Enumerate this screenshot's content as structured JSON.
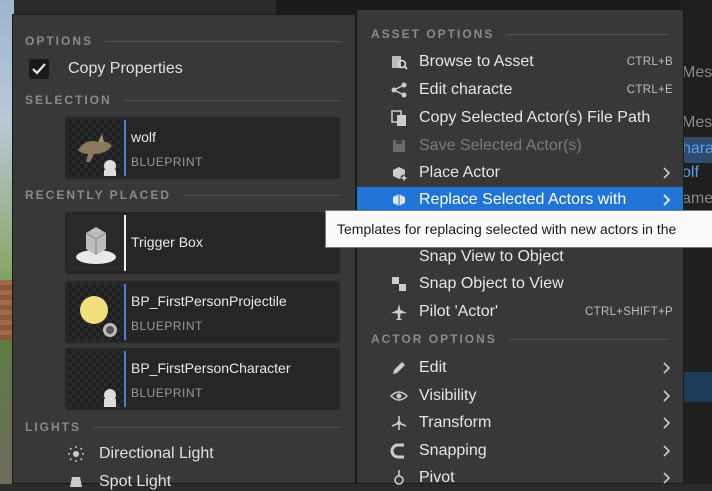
{
  "left_menu": {
    "options_header": "OPTIONS",
    "copy_properties": {
      "label": "Copy Properties",
      "checked": true
    },
    "selection_header": "SELECTION",
    "selection": {
      "name": "wolf",
      "type": "BLUEPRINT"
    },
    "recent_header": "RECENTLY PLACED",
    "recent": [
      {
        "name": "Trigger Box",
        "type": ""
      },
      {
        "name": "BP_FirstPersonProjectile",
        "type": "BLUEPRINT"
      },
      {
        "name": "BP_FirstPersonCharacter",
        "type": "BLUEPRINT"
      }
    ],
    "lights_header": "LIGHTS",
    "lights": [
      {
        "label": "Directional Light",
        "icon": "sun-icon"
      },
      {
        "label": "Spot Light",
        "icon": "spot-light-icon"
      }
    ]
  },
  "right_menu": {
    "asset_header": "ASSET OPTIONS",
    "actor_header": "ACTOR OPTIONS",
    "items": [
      {
        "label": "Browse to Asset",
        "shortcut": "CTRL+B",
        "icon": "browse-icon"
      },
      {
        "label": "Edit characte",
        "shortcut": "CTRL+E",
        "icon": "edit-asset-icon"
      },
      {
        "label": "Copy Selected Actor(s) File Path",
        "shortcut": "",
        "icon": "copy-path-icon"
      },
      {
        "label": "Save Selected Actor(s)",
        "shortcut": "",
        "icon": "save-icon",
        "disabled": true
      },
      {
        "label": "Place Actor",
        "shortcut": "",
        "icon": "place-actor-icon",
        "submenu": true
      },
      {
        "label": "Replace Selected Actors with",
        "shortcut": "",
        "icon": "replace-icon",
        "submenu": true,
        "active": true
      },
      {
        "label": "Snap View to Object",
        "shortcut": "",
        "icon": "snap-view-icon"
      },
      {
        "label": "Snap Object to View",
        "shortcut": "",
        "icon": "snap-object-icon"
      },
      {
        "label": "Pilot 'Actor'",
        "shortcut": "CTRL+SHIFT+P",
        "icon": "pilot-icon"
      }
    ],
    "actor_items": [
      {
        "label": "Edit",
        "icon": "pencil-icon",
        "submenu": true
      },
      {
        "label": "Visibility",
        "icon": "eye-icon",
        "submenu": true
      },
      {
        "label": "Transform",
        "icon": "transform-icon",
        "submenu": true
      },
      {
        "label": "Snapping",
        "icon": "magnet-icon",
        "submenu": true
      },
      {
        "label": "Pivot",
        "icon": "pivot-icon",
        "submenu": true
      }
    ]
  },
  "tooltip": "Templates for replacing selected with new actors in the",
  "background": {
    "fragments": [
      "Mes",
      "Mes",
      "hara",
      "olf",
      "ame"
    ]
  },
  "colors": {
    "accent": "#1f74d6",
    "menu_bg": "#383838",
    "asset_bar": "#4d7fd9"
  }
}
